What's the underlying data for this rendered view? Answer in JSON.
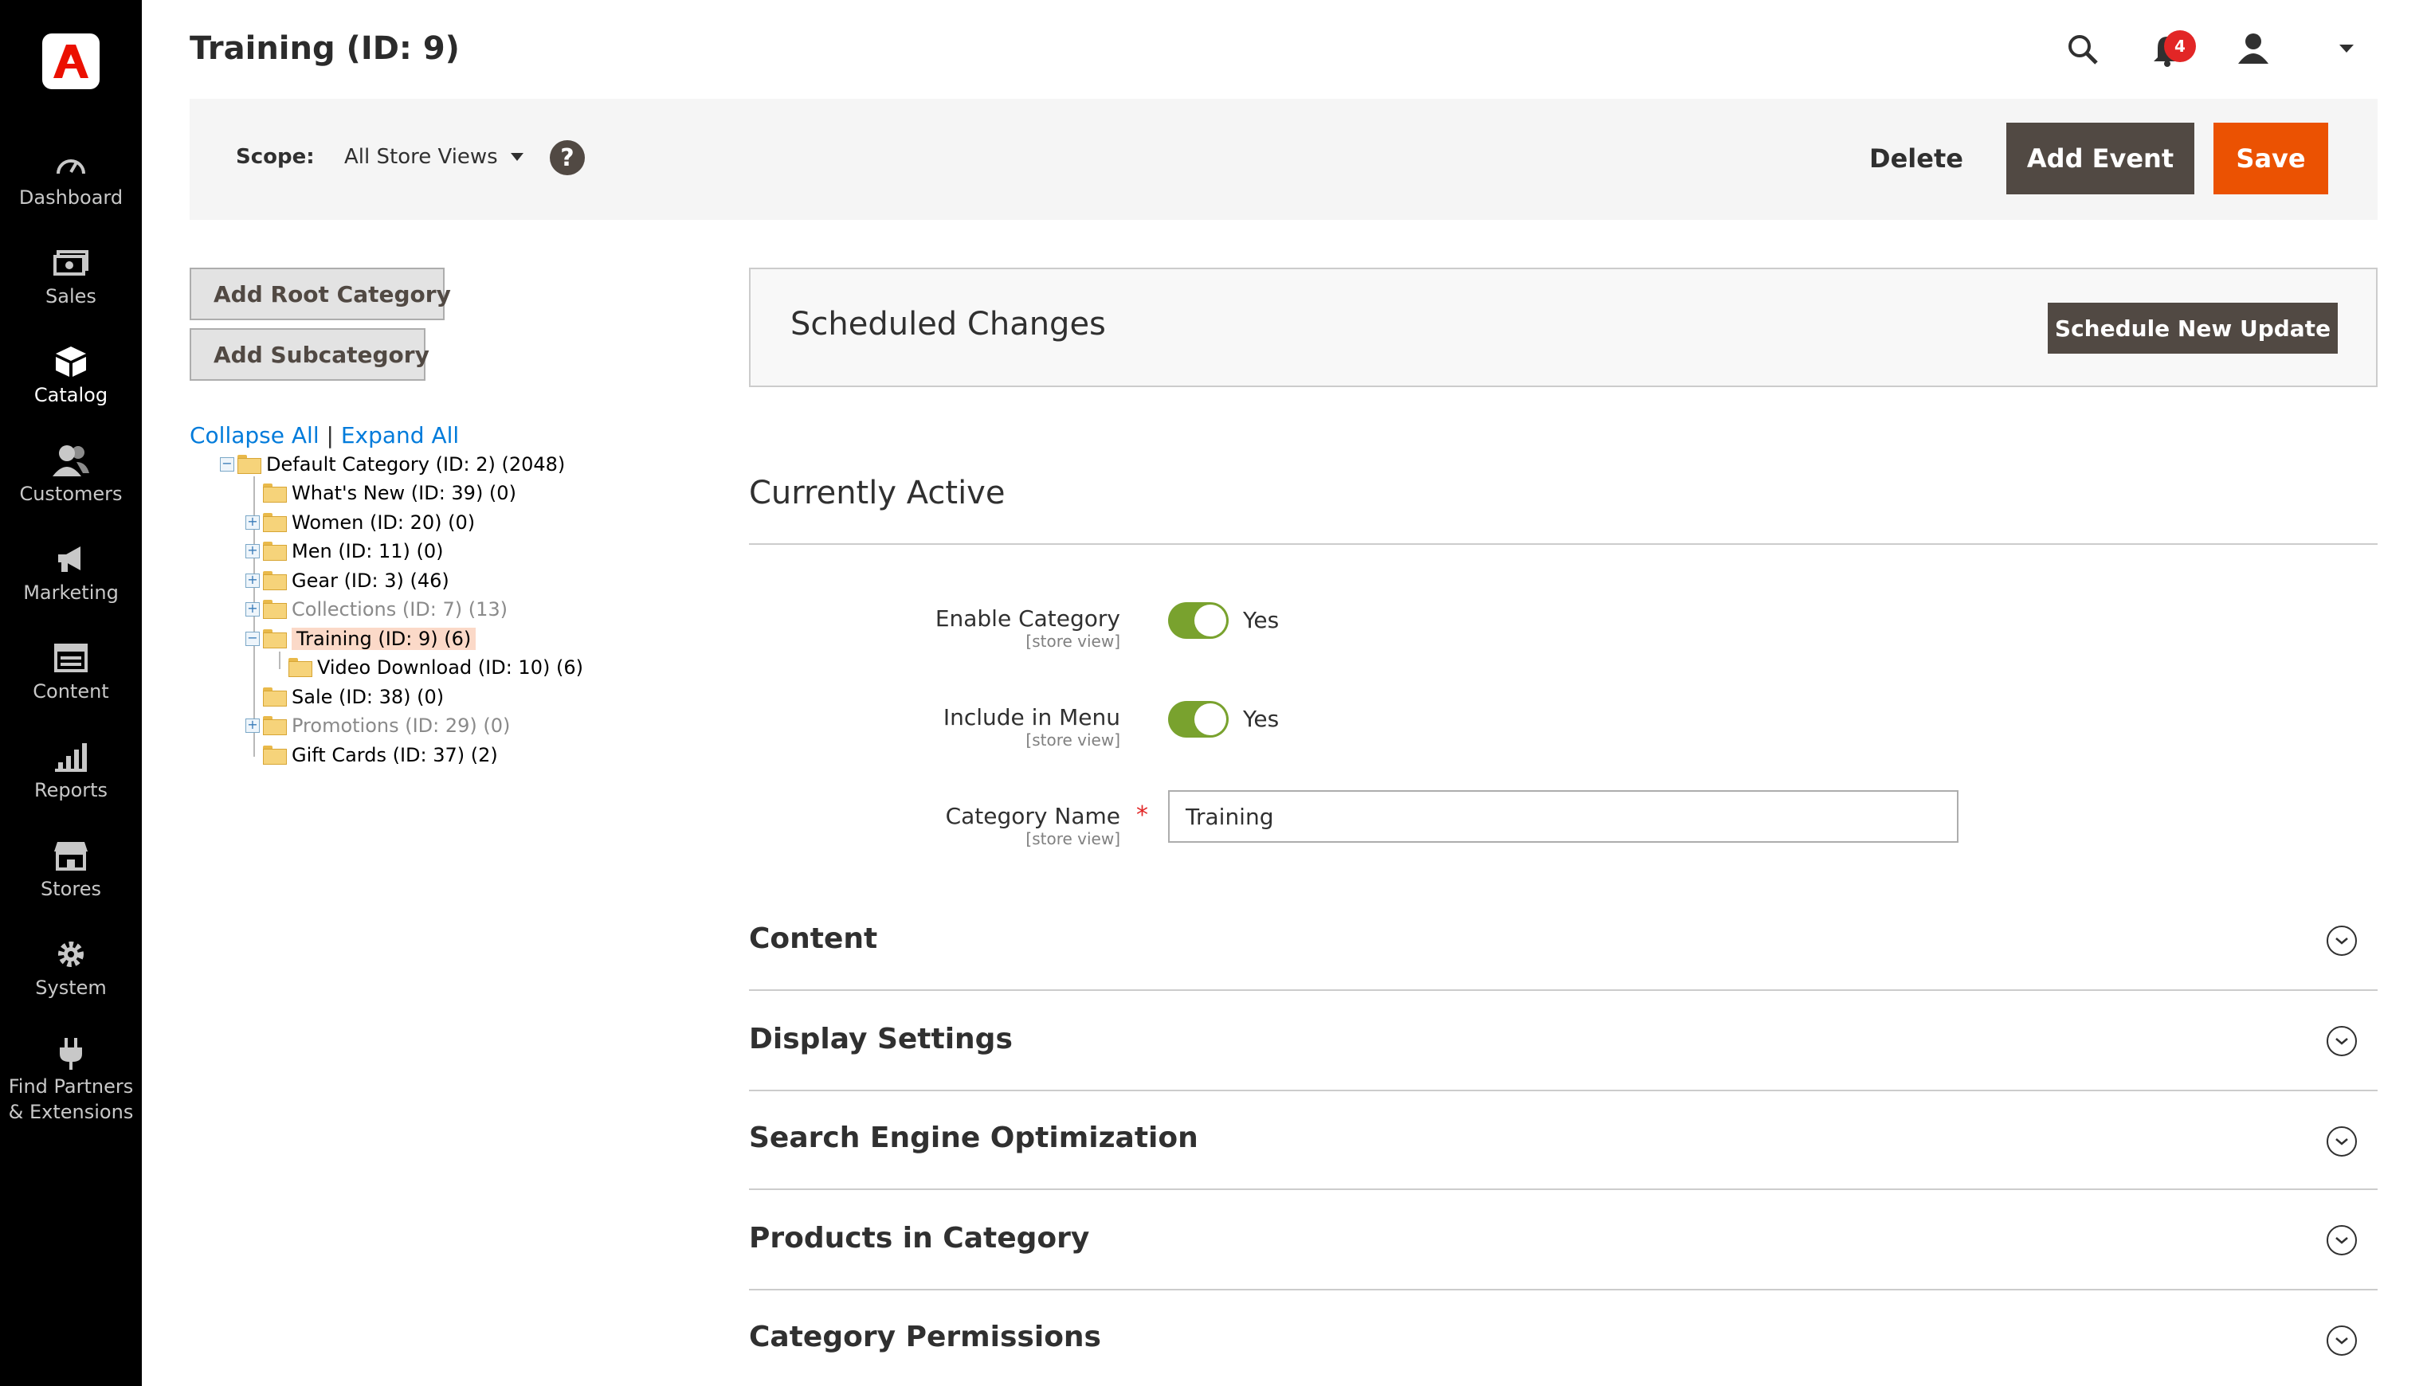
{
  "page": {
    "title": "Training (ID: 9)"
  },
  "nav": {
    "items": [
      {
        "label": "Dashboard",
        "icon": "dashboard-icon"
      },
      {
        "label": "Sales",
        "icon": "sales-icon"
      },
      {
        "label": "Catalog",
        "icon": "catalog-icon"
      },
      {
        "label": "Customers",
        "icon": "customers-icon"
      },
      {
        "label": "Marketing",
        "icon": "marketing-icon"
      },
      {
        "label": "Content",
        "icon": "content-icon"
      },
      {
        "label": "Reports",
        "icon": "reports-icon"
      },
      {
        "label": "Stores",
        "icon": "stores-icon"
      },
      {
        "label": "System",
        "icon": "gear-icon"
      },
      {
        "label": "Find Partners\n& Extensions",
        "icon": "plug-icon"
      }
    ],
    "active": "Catalog"
  },
  "header": {
    "notifications_count": "4"
  },
  "toolbar": {
    "scope_label": "Scope:",
    "scope_value": "All Store Views",
    "help": "?",
    "delete_label": "Delete",
    "add_event_label": "Add Event",
    "save_label": "Save"
  },
  "tree_panel": {
    "add_root_label": "Add Root Category",
    "add_sub_label": "Add Subcategory",
    "collapse_all": "Collapse All",
    "separator": "|",
    "expand_all": "Expand All",
    "nodes": [
      {
        "label": "Default Category (ID: 2) (2048)"
      },
      {
        "label": "What's New (ID: 39) (0)"
      },
      {
        "label": "Women (ID: 20) (0)"
      },
      {
        "label": "Men (ID: 11) (0)"
      },
      {
        "label": "Gear (ID: 3) (46)"
      },
      {
        "label": "Collections (ID: 7) (13)"
      },
      {
        "label": "Training (ID: 9) (6)"
      },
      {
        "label": "Video Download (ID: 10) (6)"
      },
      {
        "label": "Sale (ID: 38) (0)"
      },
      {
        "label": "Promotions (ID: 29) (0)"
      },
      {
        "label": "Gift Cards (ID: 37) (2)"
      }
    ]
  },
  "scheduled": {
    "title": "Scheduled Changes",
    "button_label": "Schedule New Update"
  },
  "active_section": {
    "title": "Currently Active",
    "enable_category": {
      "label": "Enable Category",
      "scope": "[store view]",
      "value": "Yes"
    },
    "include_in_menu": {
      "label": "Include in Menu",
      "scope": "[store view]",
      "value": "Yes"
    },
    "category_name": {
      "label": "Category Name",
      "scope": "[store view]",
      "required": "*",
      "value": "Training"
    }
  },
  "collapsibles": [
    {
      "title": "Content"
    },
    {
      "title": "Display Settings"
    },
    {
      "title": "Search Engine Optimization"
    },
    {
      "title": "Products in Category"
    },
    {
      "title": "Category Permissions"
    }
  ],
  "colors": {
    "accent_orange": "#eb5202",
    "button_dark": "#514943",
    "toggle_green": "#79a22e",
    "link_blue": "#007bdb",
    "badge_red": "#e22626"
  }
}
